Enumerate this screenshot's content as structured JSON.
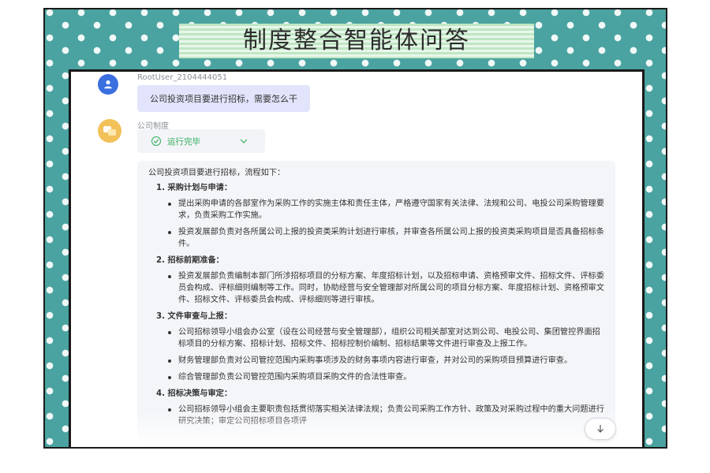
{
  "header": {
    "title": "制度整合智能体问答"
  },
  "user_message": {
    "avatar_icon": "user-icon",
    "username": "RootUser_2104444051",
    "text": "公司投资项目要进行招标，需要怎么干"
  },
  "bot_message": {
    "avatar_icon": "chat-bubbles-icon",
    "name": "公司制度",
    "status": {
      "icon": "check-circle-icon",
      "label": "运行完毕",
      "chevron_icon": "chevron-down-icon"
    },
    "intro": "公司投资项目要进行招标，流程如下：",
    "sections": [
      {
        "heading": "1. 采购计划与申请：",
        "bullets": [
          "提出采购申请的各部室作为采购工作的实施主体和责任主体，严格遵守国家有关法律、法规和公司、电投公司采购管理要求，负责采购工作实施。",
          "投资发展部负责对各所属公司上报的投资类采购计划进行审核，并审查各所属公司上报的投资类采购项目是否具备招标条件。"
        ]
      },
      {
        "heading": "2. 招标前期准备：",
        "bullets": [
          "投资发展部负责编制本部门所涉招标项目的分标方案、年度招标计划，以及招标申请、资格预审文件、招标文件、评标委员会构成、评标细则编制等工作。同时，协助经营与安全管理部对所属公司的项目分标方案、年度招标计划、资格预审文件、招标文件、评标委员会构成、评标细则等进行审核。"
        ]
      },
      {
        "heading": "3. 文件审查与上报：",
        "bullets": [
          "公司招标领导小组会办公室（设在公司经营与安全管理部），组织公司相关部室对达到公司、电投公司、集团管控界面招标项目的分标方案、招标计划、招标文件、招标控制价编制、招标结果等文件进行审查及上报工作。",
          "财务管理部负责对公司管控范围内采购事项涉及的财务事项内容进行审查，并对公司的采购项目预算进行审查。",
          "综合管理部负责公司管控范围内采购项目采购文件的合法性审查。"
        ]
      },
      {
        "heading": "4. 招标决策与审定：",
        "bullets": [
          "公司招标领导小组会主要职责包括贯彻落实相关法律法规；负责公司采购工作方针、政策及对采购过程中的重大问题进行研究决策；审定公司招标项目各项评"
        ]
      }
    ]
  },
  "scroll_button": {
    "icon": "arrow-down-icon"
  },
  "colors": {
    "frame_teal": "#4aa3a0",
    "user_avatar": "#3a6fe0",
    "bot_avatar": "#f2c15a",
    "status_green": "#2fae5a",
    "user_bubble": "#e2e4fb"
  }
}
